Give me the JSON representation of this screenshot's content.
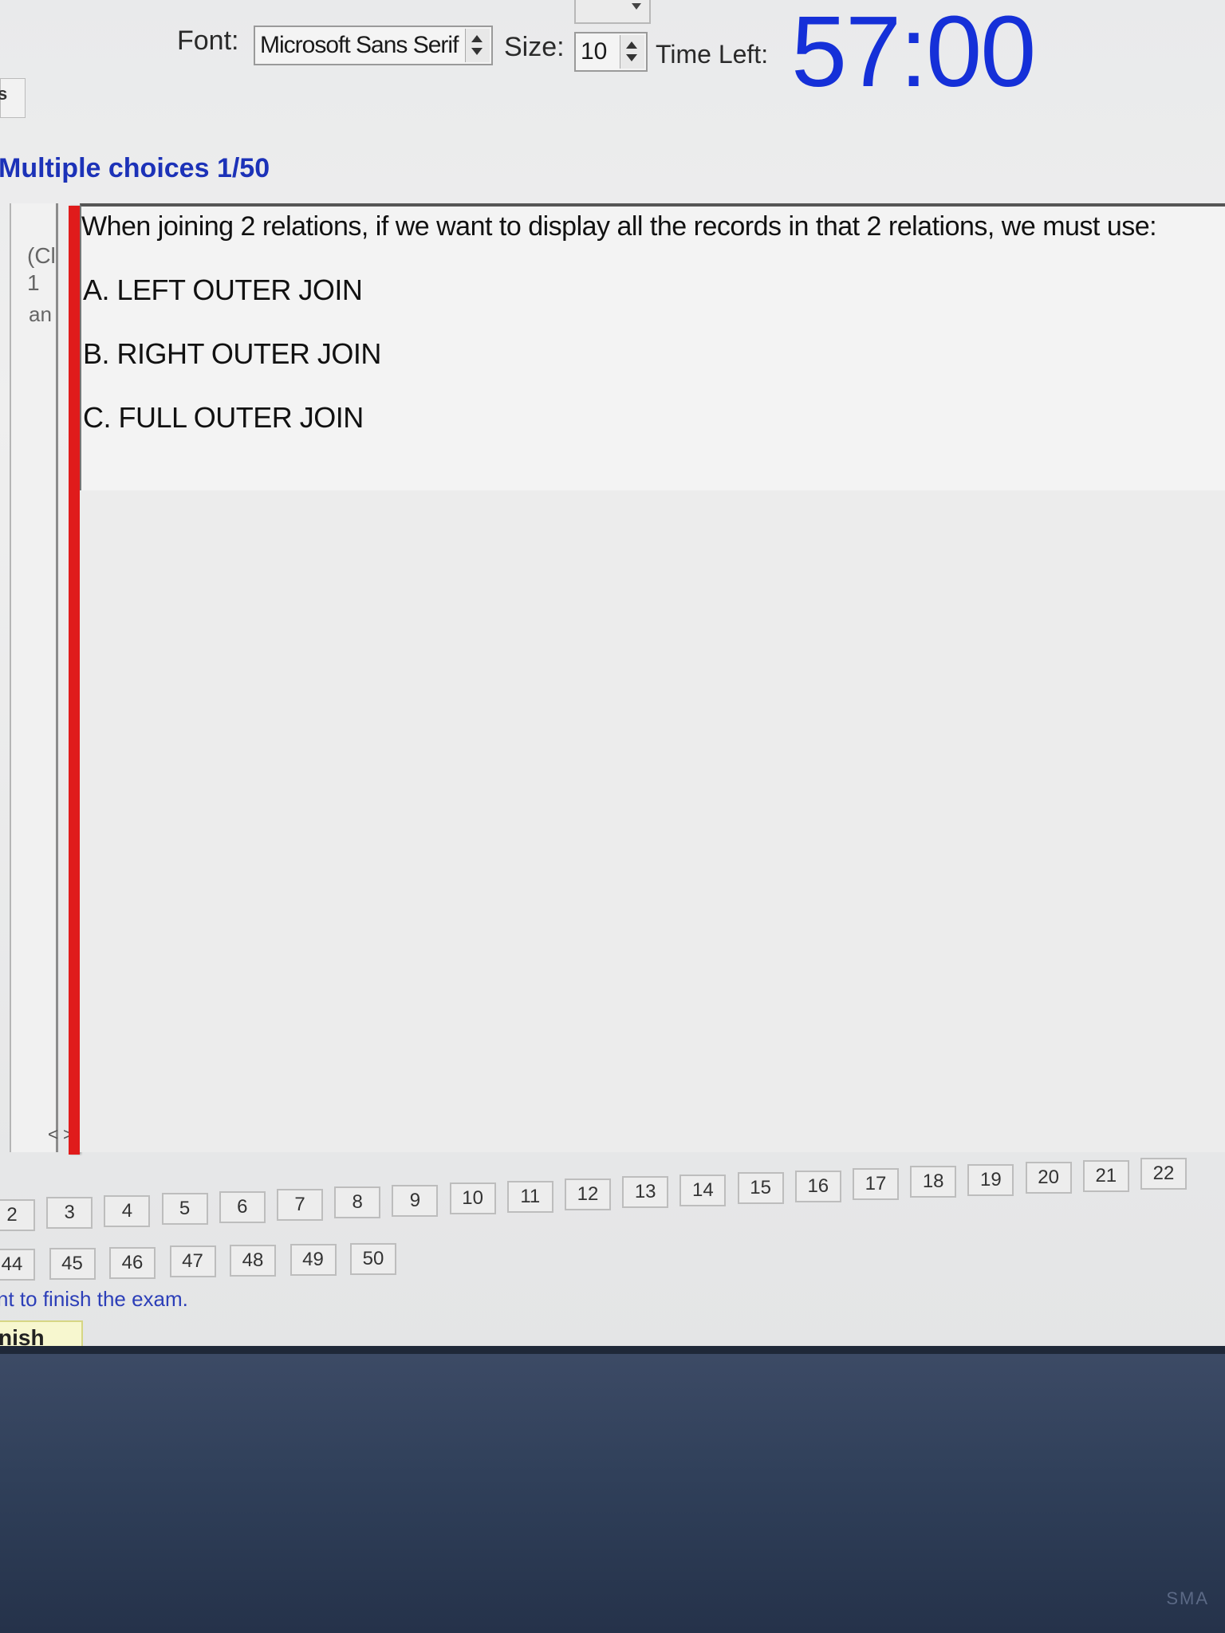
{
  "toolbar": {
    "font_label": "Font:",
    "font_value": "Microsoft Sans Serif",
    "size_label": "Size:",
    "size_value": "10",
    "time_left_label": "Time Left:",
    "timer": "57:00"
  },
  "left_strip_text": "s",
  "section_title": "Multiple choices 1/50",
  "left_fragments": [
    "(Cl",
    "1",
    "an"
  ],
  "scroll_arrows": "< >",
  "question": {
    "text": "When joining 2 relations, if we want to display all the records in that 2 relations, we must use:",
    "options": [
      "A. LEFT OUTER JOIN",
      "B. RIGHT OUTER JOIN",
      "C. FULL OUTER JOIN"
    ]
  },
  "nav_row1": [
    "2",
    "3",
    "4",
    "5",
    "6",
    "7",
    "8",
    "9",
    "10",
    "11",
    "12",
    "13",
    "14",
    "15",
    "16",
    "17",
    "18",
    "19",
    "20",
    "21",
    "22"
  ],
  "nav_row2": [
    "44",
    "45",
    "46",
    "47",
    "48",
    "49",
    "50"
  ],
  "finish_note": "nt to finish the exam.",
  "finish_button": "nish",
  "bezel_logo": "SMA"
}
